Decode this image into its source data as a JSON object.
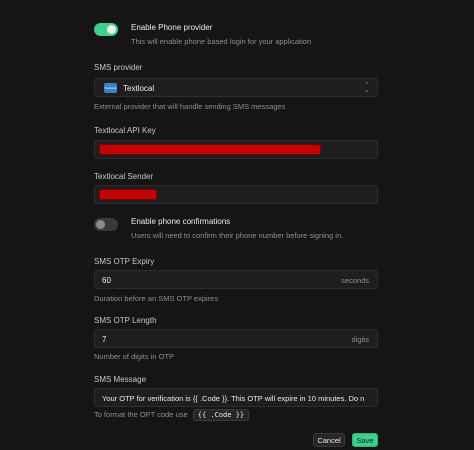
{
  "phone_provider": {
    "title": "Enable Phone provider",
    "description": "This will enable phone based login for your application",
    "enabled": true
  },
  "sms_provider": {
    "label": "SMS provider",
    "selected": "Textlocal",
    "logo_text": "Textlocal",
    "help": "External provider that will handle sending SMS messages"
  },
  "api_key": {
    "label": "Textlocal API Key"
  },
  "sender": {
    "label": "Textlocal Sender"
  },
  "phone_confirmations": {
    "title": "Enable phone confirmations",
    "description": "Users will need to confirm their phone number before signing in.",
    "enabled": false
  },
  "otp_expiry": {
    "label": "SMS OTP Expiry",
    "value": "60",
    "suffix": "seconds",
    "help": "Duration before an SMS OTP expires"
  },
  "otp_length": {
    "label": "SMS OTP Length",
    "value": "7",
    "suffix": "digits",
    "help": "Number of digits in OTP"
  },
  "sms_message": {
    "label": "SMS Message",
    "value": "Your OTP for verification is {{ .Code }}. This OTP will expire in 10 minutes. Do n",
    "help": "To format the OPT code use",
    "code_hint": "{{ .Code }}"
  },
  "actions": {
    "cancel": "Cancel",
    "save": "Save"
  },
  "colors": {
    "accent": "#3ecf8e",
    "redaction": "#c20000"
  }
}
